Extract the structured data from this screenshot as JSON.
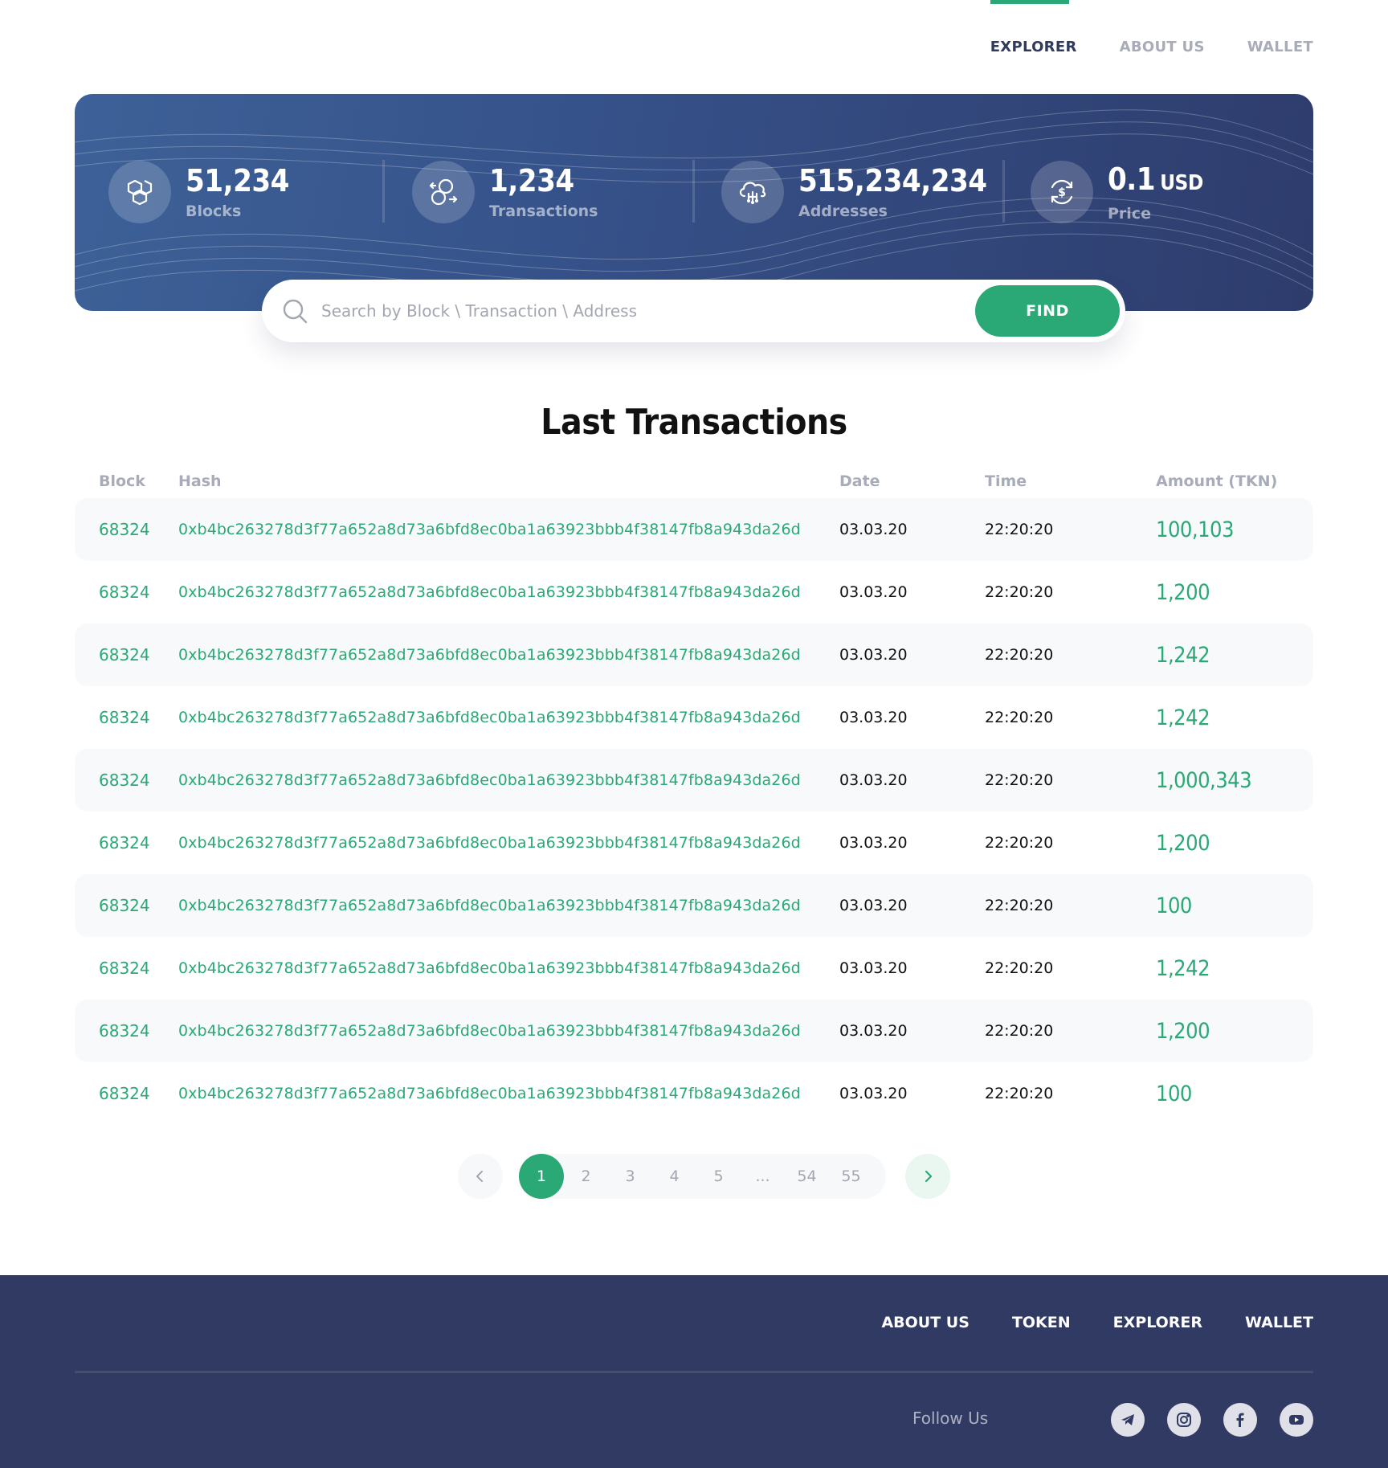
{
  "nav": {
    "items": [
      {
        "label": "EXPLORER",
        "active": true
      },
      {
        "label": "ABOUT US",
        "active": false
      },
      {
        "label": "WALLET",
        "active": false
      }
    ]
  },
  "stats": [
    {
      "value": "51,234",
      "unit": "",
      "label": "Blocks",
      "icon": "blocks-icon"
    },
    {
      "value": "1,234",
      "unit": "",
      "label": "Transactions",
      "icon": "transactions-icon"
    },
    {
      "value": "515,234,234",
      "unit": "",
      "label": "Addresses",
      "icon": "cloud-network-icon"
    },
    {
      "value": "0.1",
      "unit": "USD",
      "label": "Price",
      "icon": "dollar-refresh-icon"
    }
  ],
  "search": {
    "placeholder": "Search by Block \\ Transaction \\ Address",
    "value": "",
    "button_label": "FIND"
  },
  "section_title": "Last Transactions",
  "table": {
    "headers": {
      "block": "Block",
      "hash": "Hash",
      "date": "Date",
      "time": "Time",
      "amount": "Amount (TKN)"
    },
    "rows": [
      {
        "block": "68324",
        "hash": "0xb4bc263278d3f77a652a8d73a6bfd8ec0ba1a63923bbb4f38147fb8a943da26d",
        "date": "03.03.20",
        "time": "22:20:20",
        "amount": "100,103"
      },
      {
        "block": "68324",
        "hash": "0xb4bc263278d3f77a652a8d73a6bfd8ec0ba1a63923bbb4f38147fb8a943da26d",
        "date": "03.03.20",
        "time": "22:20:20",
        "amount": "1,200"
      },
      {
        "block": "68324",
        "hash": "0xb4bc263278d3f77a652a8d73a6bfd8ec0ba1a63923bbb4f38147fb8a943da26d",
        "date": "03.03.20",
        "time": "22:20:20",
        "amount": "1,242"
      },
      {
        "block": "68324",
        "hash": "0xb4bc263278d3f77a652a8d73a6bfd8ec0ba1a63923bbb4f38147fb8a943da26d",
        "date": "03.03.20",
        "time": "22:20:20",
        "amount": "1,242"
      },
      {
        "block": "68324",
        "hash": "0xb4bc263278d3f77a652a8d73a6bfd8ec0ba1a63923bbb4f38147fb8a943da26d",
        "date": "03.03.20",
        "time": "22:20:20",
        "amount": "1,000,343"
      },
      {
        "block": "68324",
        "hash": "0xb4bc263278d3f77a652a8d73a6bfd8ec0ba1a63923bbb4f38147fb8a943da26d",
        "date": "03.03.20",
        "time": "22:20:20",
        "amount": "1,200"
      },
      {
        "block": "68324",
        "hash": "0xb4bc263278d3f77a652a8d73a6bfd8ec0ba1a63923bbb4f38147fb8a943da26d",
        "date": "03.03.20",
        "time": "22:20:20",
        "amount": "100"
      },
      {
        "block": "68324",
        "hash": "0xb4bc263278d3f77a652a8d73a6bfd8ec0ba1a63923bbb4f38147fb8a943da26d",
        "date": "03.03.20",
        "time": "22:20:20",
        "amount": "1,242"
      },
      {
        "block": "68324",
        "hash": "0xb4bc263278d3f77a652a8d73a6bfd8ec0ba1a63923bbb4f38147fb8a943da26d",
        "date": "03.03.20",
        "time": "22:20:20",
        "amount": "1,200"
      },
      {
        "block": "68324",
        "hash": "0xb4bc263278d3f77a652a8d73a6bfd8ec0ba1a63923bbb4f38147fb8a943da26d",
        "date": "03.03.20",
        "time": "22:20:20",
        "amount": "100"
      }
    ]
  },
  "pagination": {
    "pages": [
      "1",
      "2",
      "3",
      "4",
      "5",
      "...",
      "54",
      "55"
    ],
    "current": "1",
    "prev_icon": "chevron-left-icon",
    "next_icon": "chevron-right-icon"
  },
  "footer": {
    "links": [
      "ABOUT US",
      "TOKEN",
      "EXPLORER",
      "WALLET"
    ],
    "follow_label": "Follow Us",
    "socials": [
      "telegram-icon",
      "instagram-icon",
      "facebook-icon",
      "youtube-icon"
    ]
  },
  "colors": {
    "accent": "#2aa876",
    "hero_start": "#3d6198",
    "hero_end": "#2e3c6c",
    "footer_bg": "#313a63",
    "nav_active": "#2f3a5c",
    "muted": "#a7acb8"
  }
}
